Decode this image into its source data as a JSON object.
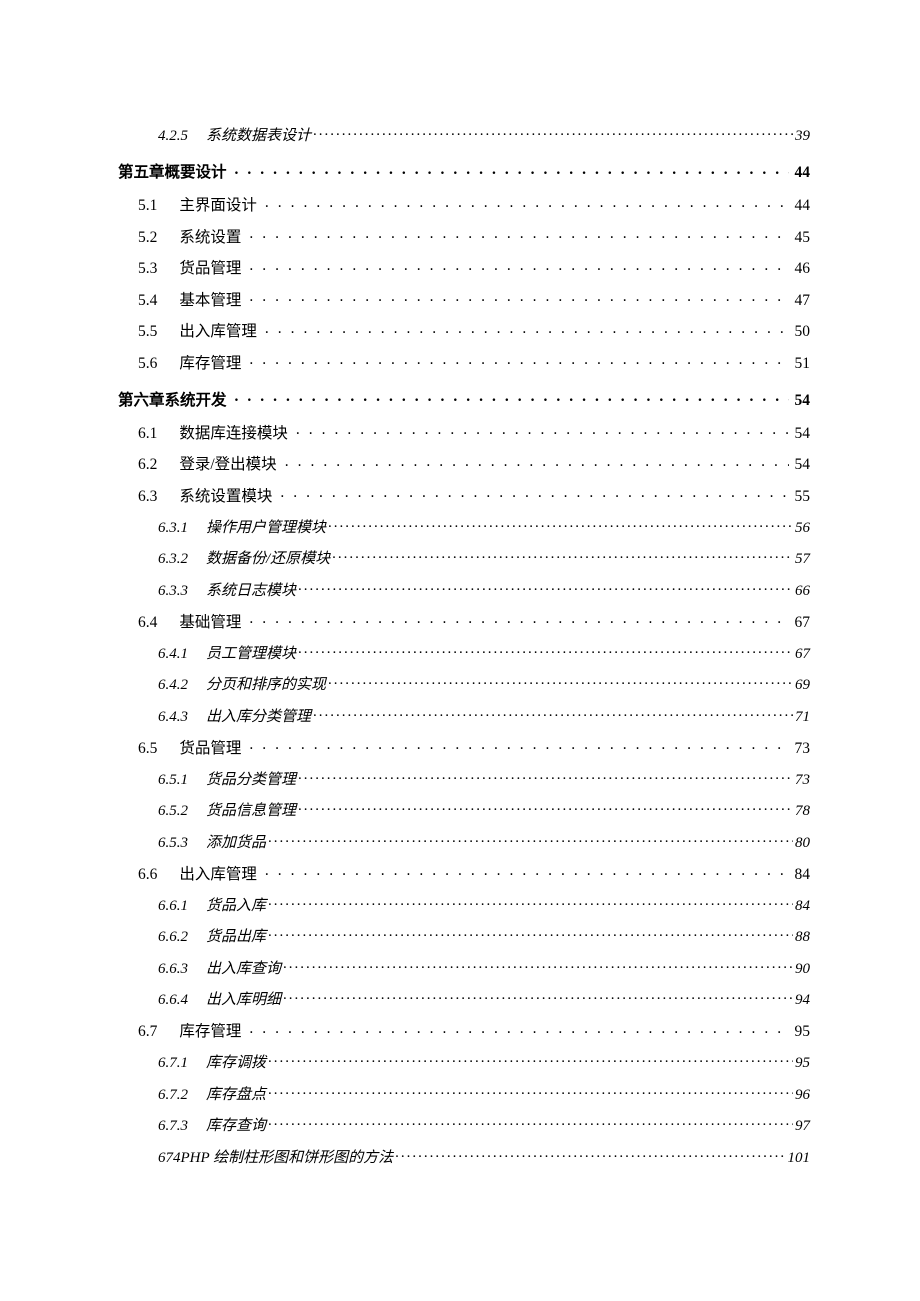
{
  "toc": [
    {
      "type": "sub",
      "indent": 40,
      "num": "4.2.5",
      "numGap": 18,
      "title": "系统数据表设计",
      "page": "39",
      "italic": true
    },
    {
      "type": "chapter",
      "indent": 0,
      "num": "",
      "numGap": 0,
      "title": "第五章概要设计",
      "page": "44",
      "italic": false,
      "chapterGap": true
    },
    {
      "type": "sec",
      "indent": 20,
      "num": "5.1",
      "numGap": 22,
      "title": "主界面设计",
      "page": "44",
      "italic": false,
      "afterChapter": true
    },
    {
      "type": "sec",
      "indent": 20,
      "num": "5.2",
      "numGap": 22,
      "title": "系统设置",
      "page": "45",
      "italic": false
    },
    {
      "type": "sec",
      "indent": 20,
      "num": "5.3",
      "numGap": 22,
      "title": "货品管理",
      "page": "46",
      "italic": false
    },
    {
      "type": "sec",
      "indent": 20,
      "num": "5.4",
      "numGap": 22,
      "title": "基本管理",
      "page": "47",
      "italic": false
    },
    {
      "type": "sec",
      "indent": 20,
      "num": "5.5",
      "numGap": 22,
      "title": "出入库管理",
      "page": "50",
      "italic": false
    },
    {
      "type": "sec",
      "indent": 20,
      "num": "5.6",
      "numGap": 22,
      "title": "库存管理",
      "page": "51",
      "italic": false
    },
    {
      "type": "chapter",
      "indent": 0,
      "num": "",
      "numGap": 0,
      "title": "第六章系统开发",
      "page": "54",
      "italic": false,
      "chapterGap": true
    },
    {
      "type": "sec",
      "indent": 20,
      "num": "6.1",
      "numGap": 22,
      "title": "数据库连接模块",
      "page": "54",
      "italic": false,
      "afterChapter": true
    },
    {
      "type": "sec",
      "indent": 20,
      "num": "6.2",
      "numGap": 22,
      "title": "登录/登出模块",
      "page": "54",
      "italic": false
    },
    {
      "type": "sec",
      "indent": 20,
      "num": "6.3",
      "numGap": 22,
      "title": "系统设置模块",
      "page": "55",
      "italic": false
    },
    {
      "type": "sub",
      "indent": 40,
      "num": "6.3.1",
      "numGap": 18,
      "title": "操作用户管理模块",
      "page": "56",
      "italic": true
    },
    {
      "type": "sub",
      "indent": 40,
      "num": "6.3.2",
      "numGap": 18,
      "title": "数据备份/还原模块",
      "page": "57",
      "italic": true
    },
    {
      "type": "sub",
      "indent": 40,
      "num": "6.3.3",
      "numGap": 18,
      "title": "系统日志模块",
      "page": "66",
      "italic": true
    },
    {
      "type": "sec",
      "indent": 20,
      "num": "6.4",
      "numGap": 22,
      "title": "基础管理",
      "page": "67",
      "italic": false
    },
    {
      "type": "sub",
      "indent": 40,
      "num": "6.4.1",
      "numGap": 18,
      "title": "员工管理模块",
      "page": "67",
      "italic": true
    },
    {
      "type": "sub",
      "indent": 40,
      "num": "6.4.2",
      "numGap": 18,
      "title": "分页和排序的实现",
      "page": "69",
      "italic": true
    },
    {
      "type": "sub",
      "indent": 40,
      "num": "6.4.3",
      "numGap": 18,
      "title": "出入库分类管理",
      "page": "71",
      "italic": true
    },
    {
      "type": "sec",
      "indent": 20,
      "num": "6.5",
      "numGap": 22,
      "title": "货品管理",
      "page": "73",
      "italic": false
    },
    {
      "type": "sub",
      "indent": 40,
      "num": "6.5.1",
      "numGap": 18,
      "title": "货品分类管理",
      "page": "73",
      "italic": true
    },
    {
      "type": "sub",
      "indent": 40,
      "num": "6.5.2",
      "numGap": 18,
      "title": "货品信息管理",
      "page": "78",
      "italic": true
    },
    {
      "type": "sub",
      "indent": 40,
      "num": "6.5.3",
      "numGap": 18,
      "title": "添加货品",
      "page": "80",
      "italic": true
    },
    {
      "type": "sec",
      "indent": 20,
      "num": "6.6",
      "numGap": 22,
      "title": "出入库管理",
      "page": "84",
      "italic": false
    },
    {
      "type": "sub",
      "indent": 40,
      "num": "6.6.1",
      "numGap": 18,
      "title": "货品入库",
      "page": "84",
      "italic": true
    },
    {
      "type": "sub",
      "indent": 40,
      "num": "6.6.2",
      "numGap": 18,
      "title": "货品出库",
      "page": "88",
      "italic": true
    },
    {
      "type": "sub",
      "indent": 40,
      "num": "6.6.3",
      "numGap": 18,
      "title": "出入库查询",
      "page": "90",
      "italic": true
    },
    {
      "type": "sub",
      "indent": 40,
      "num": "6.6.4",
      "numGap": 18,
      "title": "出入库明细",
      "page": "94",
      "italic": true
    },
    {
      "type": "sec",
      "indent": 20,
      "num": "6.7",
      "numGap": 22,
      "title": "库存管理",
      "page": "95",
      "italic": false
    },
    {
      "type": "sub",
      "indent": 40,
      "num": "6.7.1",
      "numGap": 18,
      "title": "库存调拨",
      "page": "95",
      "italic": true
    },
    {
      "type": "sub",
      "indent": 40,
      "num": "6.7.2",
      "numGap": 18,
      "title": "库存盘点",
      "page": "96",
      "italic": true
    },
    {
      "type": "sub",
      "indent": 40,
      "num": "6.7.3",
      "numGap": 18,
      "title": "库存查询",
      "page": "97",
      "italic": true
    },
    {
      "type": "sub",
      "indent": 40,
      "num": "",
      "numGap": 0,
      "title": "674PHP 绘制柱形图和饼形图的方法",
      "page": "101",
      "italic": true
    }
  ],
  "style": {
    "fontSizeChapter": "15.5px",
    "fontSizeSec": "15.5px",
    "fontSizeSub": "15px",
    "letterSpacingSec": "0px",
    "leaderLetterSpacingChapter": "9px",
    "leaderLetterSpacingSec": "9px",
    "leaderLetterSpacingSub": "2px"
  }
}
